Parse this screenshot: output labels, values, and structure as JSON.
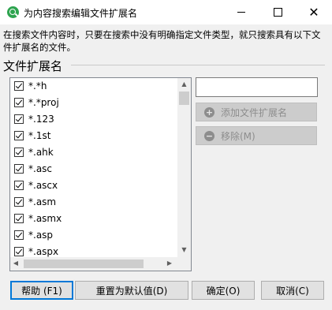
{
  "window": {
    "title": "为内容搜索编辑文件扩展名"
  },
  "description": "在搜索文件内容时，只要在搜索中没有明确指定文件类型，就只搜索具有以下文件扩展名的文件。",
  "group_label": "文件扩展名",
  "extensions": [
    {
      "label": "*.*h",
      "checked": true
    },
    {
      "label": "*.*proj",
      "checked": true
    },
    {
      "label": "*.123",
      "checked": true
    },
    {
      "label": "*.1st",
      "checked": true
    },
    {
      "label": "*.ahk",
      "checked": true
    },
    {
      "label": "*.asc",
      "checked": true
    },
    {
      "label": "*.ascx",
      "checked": true
    },
    {
      "label": "*.asm",
      "checked": true
    },
    {
      "label": "*.asmx",
      "checked": true
    },
    {
      "label": "*.asp",
      "checked": true
    },
    {
      "label": "*.aspx",
      "checked": true
    }
  ],
  "input": {
    "value": ""
  },
  "buttons": {
    "add": "添加文件扩展名",
    "remove": "移除(M)",
    "help": "帮助 (F1)",
    "reset": "重置为默认值(D)",
    "ok": "确定(O)",
    "cancel": "取消(C)"
  },
  "icons": {
    "app": "search-icon",
    "add": "plus-circle-icon",
    "remove": "minus-circle-icon"
  },
  "colors": {
    "accent": "#0078d7",
    "app_icon": "#2ea44f"
  }
}
